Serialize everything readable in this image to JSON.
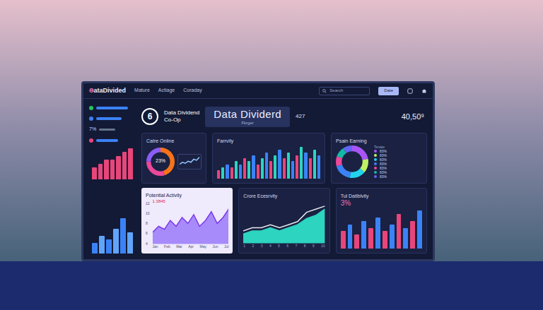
{
  "header": {
    "logo_mark": "Ə",
    "logo": "ataDivided",
    "nav": [
      "Mature",
      "Actiage",
      "Coraday"
    ],
    "search": "Search",
    "button": "Date"
  },
  "sidebar": {
    "rows": [
      {
        "color": "#22c55e",
        "level": 0.8
      },
      {
        "color": "#3b82f6",
        "level": 0.65
      },
      {
        "color": "#e8457a",
        "level": 0.55
      }
    ],
    "percent": {
      "label": "7%",
      "level": 0.45
    },
    "bars": [
      3,
      4,
      5,
      5,
      6,
      7,
      8
    ],
    "bars2": [
      3,
      5,
      4,
      7,
      10,
      6
    ]
  },
  "summary": {
    "badge": "6",
    "title": "Data Dividend",
    "subtitle": "Co-Op",
    "hero_title": "Data Dividerd",
    "hero_sub": "Fkrger",
    "count": "427",
    "total": "40,50⁹"
  },
  "catre_online": {
    "title": "Catre Online",
    "value": "23%",
    "segments": [
      {
        "value": 45,
        "color": "#f97316"
      },
      {
        "value": 30,
        "color": "#ec4899"
      },
      {
        "value": 25,
        "color": "#8b5cf6"
      }
    ],
    "mini": [
      3,
      5,
      4,
      6,
      5,
      8,
      7,
      10
    ]
  },
  "farrvity": {
    "title": "Farrvity",
    "values": [
      3,
      4,
      5,
      4,
      6,
      5,
      7,
      6,
      8,
      5,
      7,
      9,
      6,
      8,
      10,
      7,
      9,
      6,
      8,
      11,
      9,
      7,
      10,
      8
    ]
  },
  "psain_earning": {
    "title": "Psain Earning",
    "legend_title": "Tenate",
    "segments": [
      {
        "label": "83%",
        "value": 22,
        "color": "#a855f7"
      },
      {
        "label": "83%",
        "value": 14,
        "color": "#bef264"
      },
      {
        "label": "83%",
        "value": 16,
        "color": "#22d3ee"
      },
      {
        "label": "83%",
        "value": 18,
        "color": "#3b82f6"
      },
      {
        "label": "83%",
        "value": 10,
        "color": "#ec4899"
      },
      {
        "label": "83%",
        "value": 10,
        "color": "#14b8a6"
      },
      {
        "label": "83%",
        "value": 10,
        "color": "#6366f1"
      }
    ]
  },
  "potential_activity": {
    "title": "Potential Activity",
    "label": "1.3845",
    "y_ticks": [
      "12",
      "10",
      "8",
      "6",
      "4"
    ],
    "x_ticks": [
      "Jan",
      "Feb",
      "Mar",
      "Apr",
      "May",
      "Jun",
      "Jul"
    ],
    "values": [
      4,
      6,
      5,
      8,
      6,
      9,
      7,
      10,
      6,
      8,
      11,
      7,
      9,
      12
    ]
  },
  "crore_ecesrvity": {
    "title": "Crore Ecesrvity",
    "x_ticks": [
      "1",
      "2",
      "3",
      "4",
      "5",
      "6",
      "7",
      "8",
      "9",
      "10"
    ],
    "series": [
      {
        "color": "#2dd4bf",
        "values": [
          3,
          4,
          4,
          5,
          4,
          5,
          6,
          8,
          9,
          11
        ]
      },
      {
        "color": "#e5e7eb",
        "values": [
          4,
          5,
          5,
          6,
          5,
          6,
          7,
          10,
          11,
          12
        ]
      }
    ]
  },
  "tul_datiblvity": {
    "title": "Tul Datiblvity",
    "value": "3%",
    "values": [
      5,
      7,
      4,
      8,
      6,
      9,
      5,
      7,
      10,
      6,
      8,
      11
    ]
  }
}
